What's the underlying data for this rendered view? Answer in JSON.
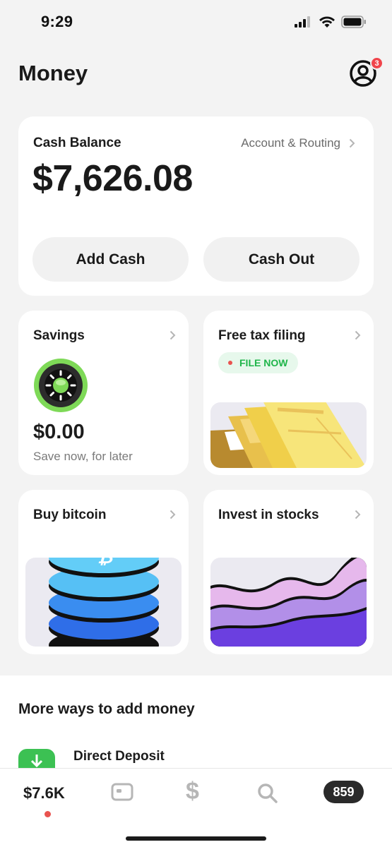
{
  "status_bar": {
    "time": "9:29"
  },
  "header": {
    "title": "Money",
    "notification_count": "3"
  },
  "balance_card": {
    "label": "Cash Balance",
    "account_link": "Account & Routing",
    "amount": "$7,626.08",
    "add_cash_label": "Add Cash",
    "cash_out_label": "Cash Out"
  },
  "tiles": {
    "savings": {
      "title": "Savings",
      "amount": "$0.00",
      "subtitle": "Save now, for later"
    },
    "tax": {
      "title": "Free tax filing",
      "badge": "FILE NOW"
    },
    "bitcoin": {
      "title": "Buy bitcoin"
    },
    "stocks": {
      "title": "Invest in stocks"
    }
  },
  "more_ways": {
    "title": "More ways to add money",
    "items": [
      {
        "label": "Direct Deposit",
        "icon": "down-arrow-icon"
      }
    ]
  },
  "tab_bar": {
    "balance": "$7.6K",
    "dollar_glyph": "$",
    "activity_count": "859"
  },
  "colors": {
    "accent_green": "#3cc153",
    "badge_red": "#f0444b",
    "file_now_green": "#1fb54a",
    "background": "#f3f3f3"
  }
}
